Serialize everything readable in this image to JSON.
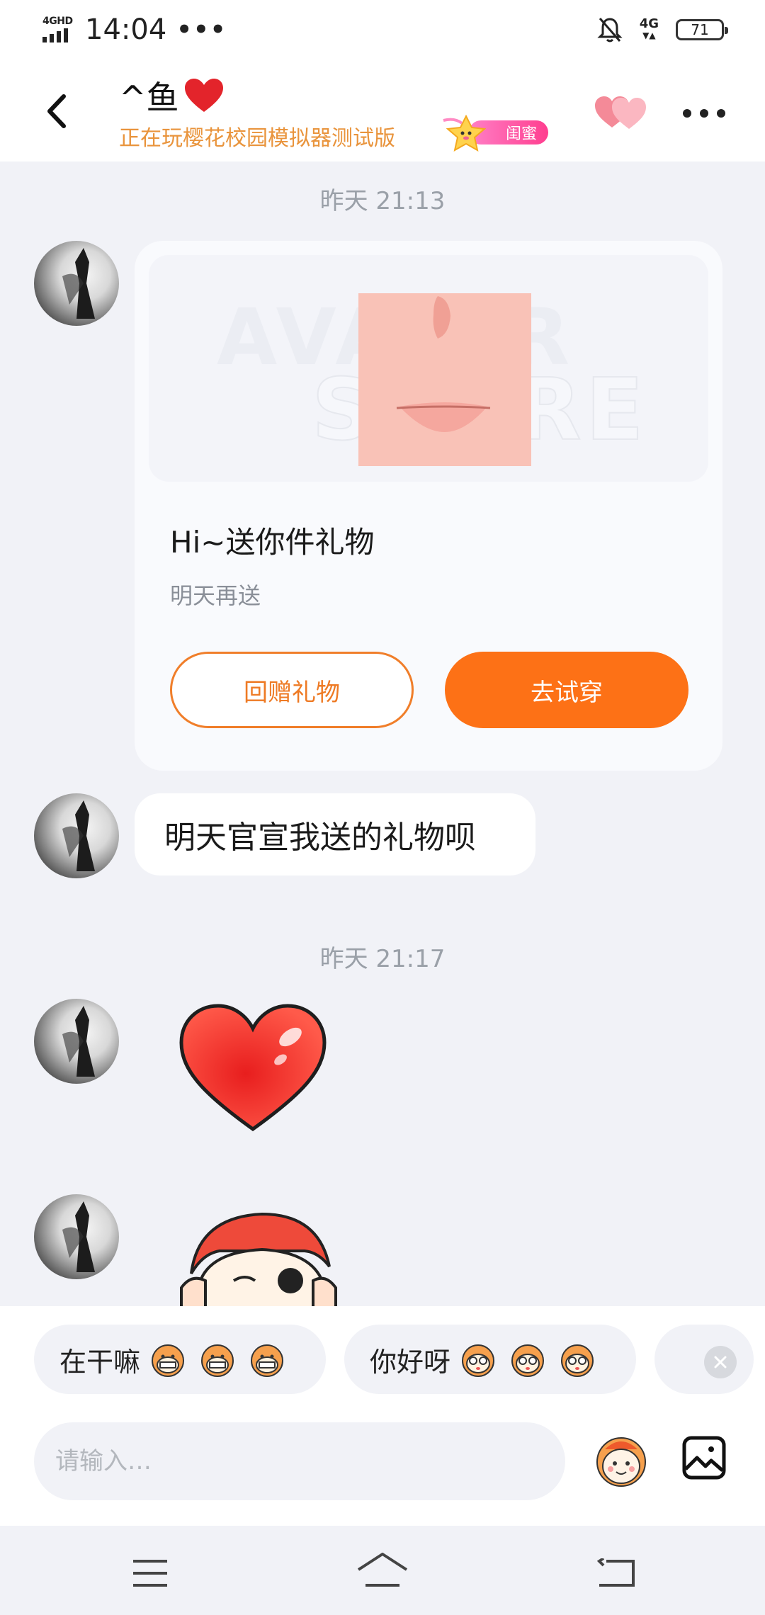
{
  "status_bar": {
    "network_label": "4GHD",
    "time": "14:04",
    "overflow": "•••",
    "right_network": "4G",
    "battery": "71"
  },
  "header": {
    "contact_name": "^鱼",
    "contact_status": "正在玩樱花校园模拟器测试版",
    "relationship_badge": "闺蜜"
  },
  "messages": {
    "timestamp_1": "昨天 21:13",
    "gift_card": {
      "watermark_top": "AVATAR",
      "watermark_bottom": "STORE",
      "title": "Hi~送你件礼物",
      "subtitle": "明天再送",
      "return_button": "回赠礼物",
      "try_button": "去试穿"
    },
    "text_1": "明天官宣我送的礼物呗",
    "timestamp_2": "昨天 21:17"
  },
  "quick_replies": [
    {
      "text": "在干嘛"
    },
    {
      "text": "你好呀"
    }
  ],
  "input": {
    "placeholder": "请输入…"
  },
  "colors": {
    "accent_orange": "#fd7116",
    "status_orange": "#e9943c",
    "badge_pink": "#ff4f9a",
    "background": "#f1f2f7"
  }
}
